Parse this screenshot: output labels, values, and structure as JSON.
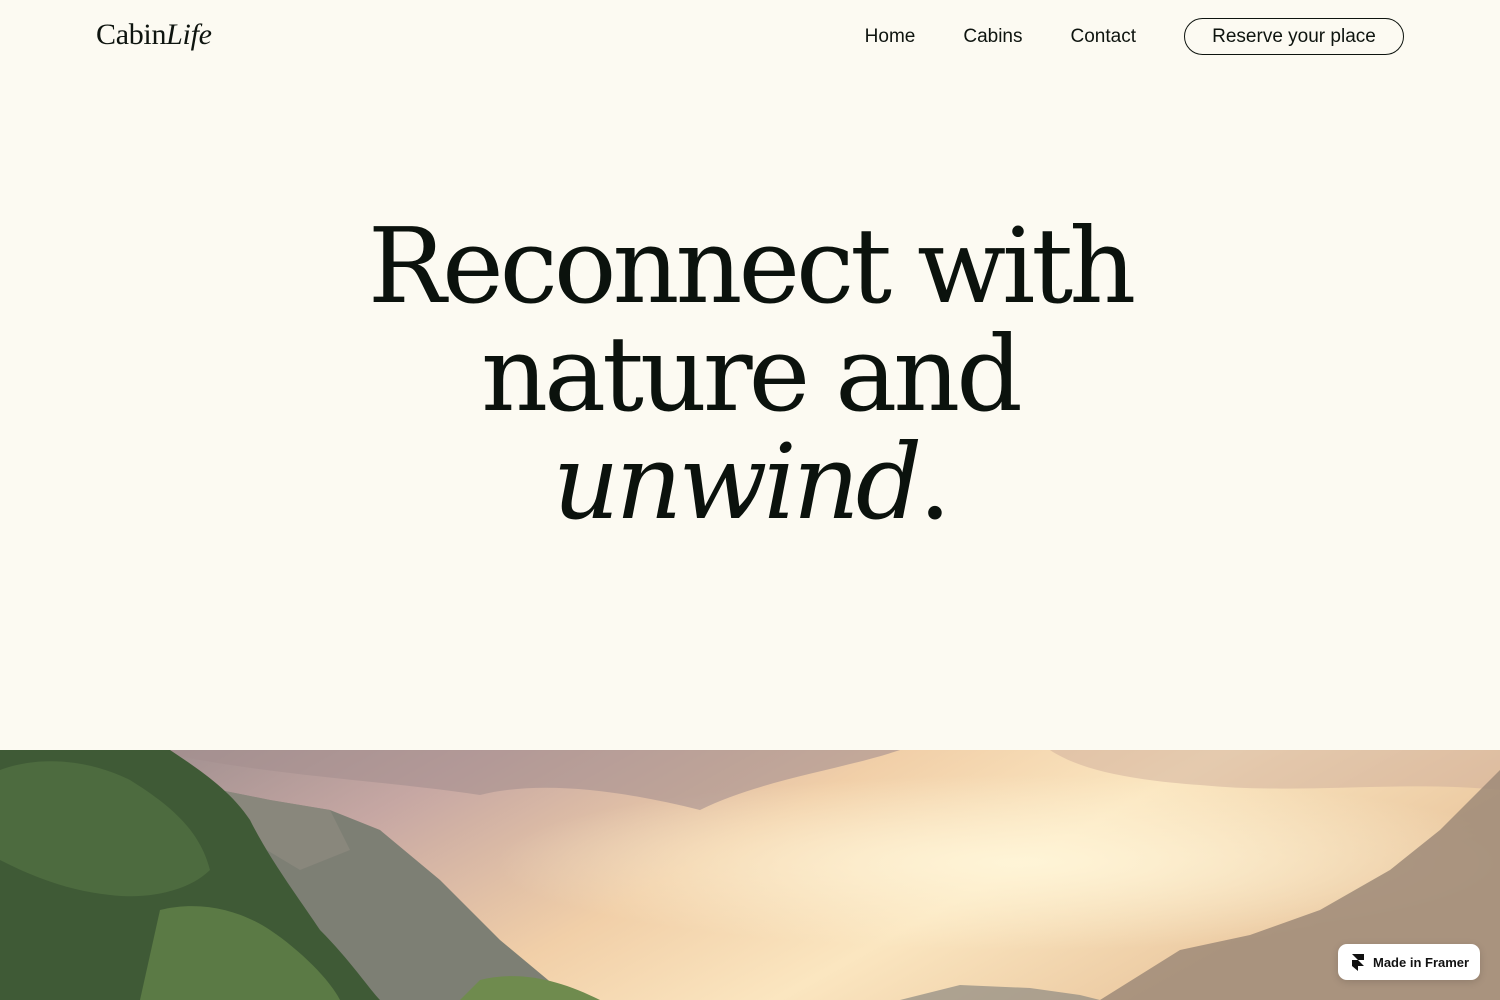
{
  "header": {
    "logo": {
      "regular": "Cabin",
      "italic": "Life"
    },
    "nav": {
      "home": "Home",
      "cabins": "Cabins",
      "contact": "Contact"
    },
    "cta_label": "Reserve your place"
  },
  "hero": {
    "line1": "Reconnect with",
    "line2": "nature and",
    "line3_italic": "unwind",
    "line3_suffix": "."
  },
  "landscape": {
    "icon": "mountain-sunset-photo"
  },
  "badge": {
    "label": "Made in Framer",
    "icon": "framer-icon"
  },
  "colors": {
    "background": "#FCFAF2",
    "text": "#0E140F"
  }
}
